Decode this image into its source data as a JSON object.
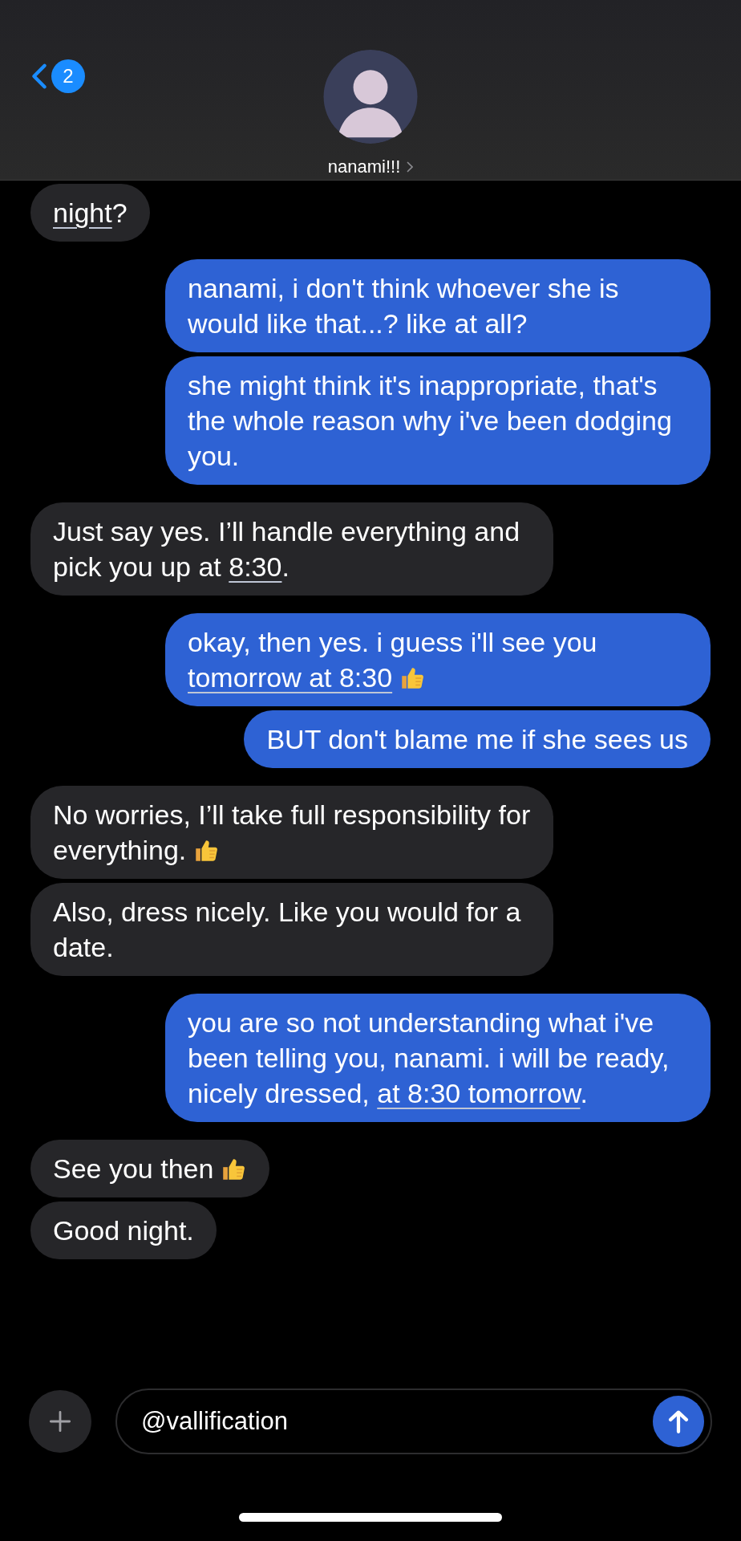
{
  "header": {
    "back_badge": "2",
    "contact_name": "nanami!!!"
  },
  "messages": [
    {
      "outgoing": false,
      "parts": [
        {
          "kind": "link",
          "text": "night"
        },
        {
          "kind": "text",
          "text": "?"
        }
      ]
    },
    {
      "outgoing": true,
      "parts": [
        {
          "kind": "text",
          "text": "nanami, i don't think whoever she is would like that...? like at all?"
        }
      ]
    },
    {
      "outgoing": true,
      "parts": [
        {
          "kind": "text",
          "text": "she might think it's inappropriate, that's the whole reason why i've been dodging you."
        }
      ]
    },
    {
      "outgoing": false,
      "parts": [
        {
          "kind": "text",
          "text": "Just say yes. I’ll handle everything and pick you up at "
        },
        {
          "kind": "link",
          "text": "8:30"
        },
        {
          "kind": "text",
          "text": "."
        }
      ]
    },
    {
      "outgoing": true,
      "parts": [
        {
          "kind": "text",
          "text": "okay, then yes. i guess i'll see you "
        },
        {
          "kind": "link",
          "text": "tomorrow at 8:30"
        },
        {
          "kind": "emoji"
        }
      ]
    },
    {
      "outgoing": true,
      "parts": [
        {
          "kind": "text",
          "text": "BUT don't blame me if she sees us"
        }
      ]
    },
    {
      "outgoing": false,
      "parts": [
        {
          "kind": "text",
          "text": "No worries, I’ll take full responsibility for everything."
        },
        {
          "kind": "emoji"
        }
      ]
    },
    {
      "outgoing": false,
      "parts": [
        {
          "kind": "text",
          "text": "Also, dress nicely. Like you would for a date."
        }
      ]
    },
    {
      "outgoing": true,
      "parts": [
        {
          "kind": "text",
          "text": "you are so not understanding what i've been telling you, nanami. i will be ready, nicely dressed, "
        },
        {
          "kind": "link",
          "text": "at 8:30 tomorrow"
        },
        {
          "kind": "text",
          "text": "."
        }
      ]
    },
    {
      "outgoing": false,
      "parts": [
        {
          "kind": "text",
          "text": "See you then"
        },
        {
          "kind": "emoji"
        }
      ]
    },
    {
      "outgoing": false,
      "parts": [
        {
          "kind": "text",
          "text": "Good night."
        }
      ]
    }
  ],
  "composer": {
    "value": "@vallification"
  }
}
